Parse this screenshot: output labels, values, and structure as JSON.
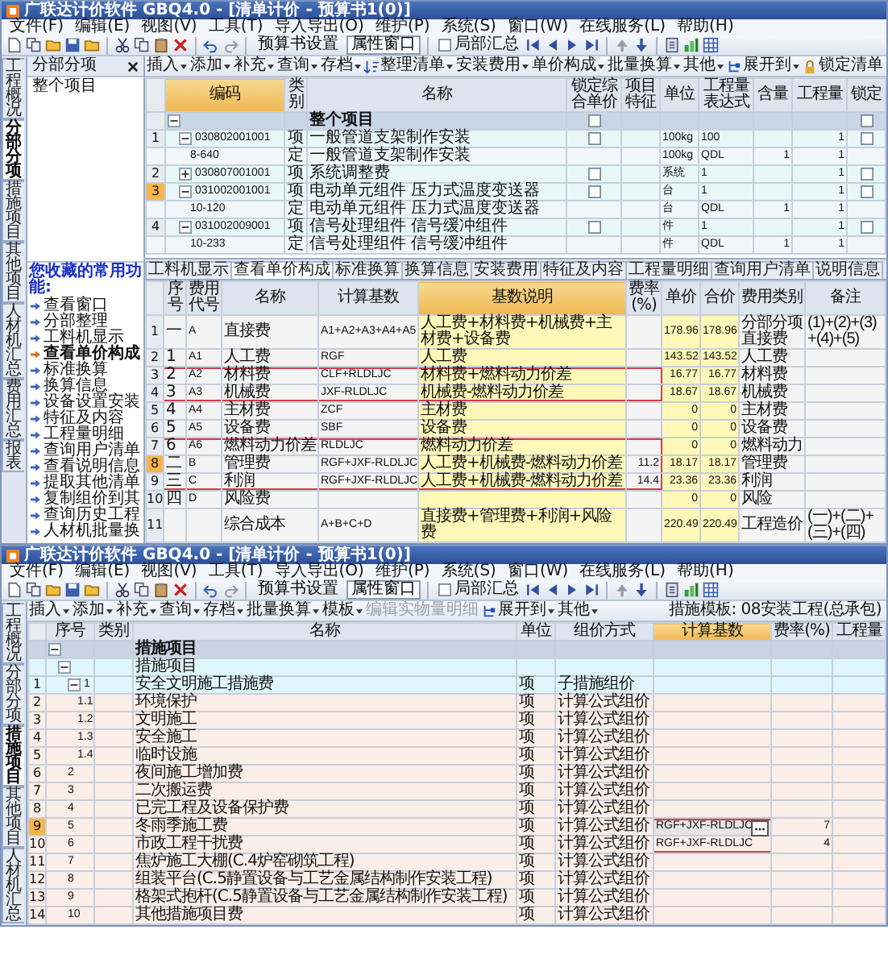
{
  "windows": [
    {
      "title": "广联达计价软件 GBQ4.0 - [清单计价 - 预算书1(0)]",
      "menu": [
        "文件(F)",
        "编辑(E)",
        "视图(V)",
        "工具(T)",
        "导入导出(O)",
        "维护(P)",
        "系统(S)",
        "窗口(W)",
        "在线服务(L)",
        "帮助(H)"
      ],
      "toolbar": {
        "buttons": [
          "预算书设置",
          "属性窗口"
        ],
        "summary": {
          "label": "局部汇总",
          "checked": false
        }
      },
      "side_tabs": [
        {
          "label": "工程概况",
          "selected": false
        },
        {
          "label": "分部分项",
          "selected": true
        },
        {
          "label": "措施项目",
          "selected": false
        },
        {
          "label": "其他项目",
          "selected": false
        },
        {
          "label": "人材机汇总",
          "selected": false
        },
        {
          "label": "费用汇总",
          "selected": false
        },
        {
          "label": "报表",
          "selected": false
        }
      ],
      "sidebar": {
        "title": "分部分项",
        "tree": [
          {
            "label": "整个项目"
          }
        ],
        "favorites_title": "您收藏的常用功能:",
        "favorites": [
          {
            "label": "查看窗口",
            "selected": false
          },
          {
            "label": "分部整理",
            "selected": false
          },
          {
            "label": "工料机显示",
            "selected": false
          },
          {
            "label": "查看单价构成",
            "selected": true
          },
          {
            "label": "标准换算",
            "selected": false
          },
          {
            "label": "换算信息",
            "selected": false
          },
          {
            "label": "设备设置安装",
            "selected": false
          },
          {
            "label": "特征及内容",
            "selected": false
          },
          {
            "label": "工程量明细",
            "selected": false
          },
          {
            "label": "查询用户清单",
            "selected": false
          },
          {
            "label": "查看说明信息",
            "selected": false
          },
          {
            "label": "提取其他清单",
            "selected": false
          },
          {
            "label": "复制组价到其",
            "selected": false
          },
          {
            "label": "查询历史工程",
            "selected": false
          },
          {
            "label": "人材机批量换",
            "selected": false
          }
        ]
      },
      "ribbon": [
        {
          "label": "插入",
          "kind": "menu",
          "disabled": false
        },
        {
          "label": "添加",
          "kind": "menu",
          "disabled": false
        },
        {
          "label": "补充",
          "kind": "menu",
          "disabled": false
        },
        {
          "label": "查询",
          "kind": "menu",
          "disabled": false
        },
        {
          "label": "存档",
          "kind": "menu",
          "disabled": false
        },
        {
          "label": "整理清单",
          "kind": "sort",
          "disabled": false
        },
        {
          "label": "安装费用",
          "kind": "menu",
          "disabled": false
        },
        {
          "label": "单价构成",
          "kind": "menu",
          "disabled": false
        },
        {
          "label": "批量换算",
          "kind": "menu",
          "disabled": false
        },
        {
          "label": "其他",
          "kind": "menu",
          "disabled": false
        },
        {
          "label": "展开到",
          "kind": "expand",
          "disabled": false
        },
        {
          "label": "锁定清单",
          "kind": "lock",
          "disabled": false
        }
      ],
      "bill_table": {
        "columns": [
          {
            "label": "编码",
            "selected": true
          },
          {
            "label": "类别",
            "selected": false
          },
          {
            "label": "名称",
            "selected": false
          },
          {
            "label": "锁定综合单价",
            "selected": false
          },
          {
            "label": "项目特征",
            "selected": false
          },
          {
            "label": "单位",
            "selected": false
          },
          {
            "label": "工程量表达式",
            "selected": false
          },
          {
            "label": "含量",
            "selected": false
          },
          {
            "label": "工程量",
            "selected": false
          },
          {
            "label": "锁定",
            "selected": false
          }
        ],
        "rows": [
          {
            "kind": "root",
            "name": "整个项目",
            "expanded": true,
            "lock_price": false,
            "lock": false,
            "selected": false,
            "children": [
              {
                "kind": "item",
                "index": "1",
                "code": "030802001001",
                "type": "项",
                "name": "一般管道支架制作安装",
                "unit": "100kg",
                "expression": "100",
                "quantity": "1",
                "expanded": true,
                "lock_price": false,
                "lock": false,
                "selected": false,
                "children": [
                  {
                    "kind": "quota",
                    "code": "8-640",
                    "type": "定",
                    "name": "一般管道支架制作安装",
                    "unit": "100kg",
                    "expression": "QDL",
                    "content": "1",
                    "quantity": "1",
                    "selected": false
                  }
                ]
              },
              {
                "kind": "item",
                "index": "2",
                "code": "030807001001",
                "type": "项",
                "name": "系统调整费",
                "unit": "系统",
                "expression": "1",
                "quantity": "1",
                "expanded": false,
                "lock_price": false,
                "lock": false,
                "selected": false
              },
              {
                "kind": "item",
                "index": "3",
                "code": "031002001001",
                "type": "项",
                "name": "电动单元组件 压力式温度变送器",
                "unit": "台",
                "expression": "1",
                "quantity": "1",
                "expanded": true,
                "lock_price": false,
                "lock": false,
                "selected": true,
                "children": [
                  {
                    "kind": "quota",
                    "code": "10-120",
                    "type": "定",
                    "name": "电动单元组件 压力式温度变送器",
                    "unit": "台",
                    "expression": "QDL",
                    "content": "1",
                    "quantity": "1",
                    "selected": false
                  }
                ]
              },
              {
                "kind": "item",
                "index": "4",
                "code": "031002009001",
                "type": "项",
                "name": "信号处理组件 信号缓冲组件",
                "unit": "件",
                "expression": "1",
                "quantity": "1",
                "expanded": true,
                "lock_price": false,
                "lock": false,
                "selected": false,
                "children": [
                  {
                    "kind": "quota",
                    "code": "10-233",
                    "type": "定",
                    "name": "信号处理组件 信号缓冲组件",
                    "unit": "件",
                    "expression": "QDL",
                    "content": "1",
                    "quantity": "1",
                    "selected": false
                  }
                ]
              }
            ]
          }
        ]
      },
      "detail_tabs": [
        {
          "label": "工料机显示",
          "selected": false
        },
        {
          "label": "查看单价构成",
          "selected": true
        },
        {
          "label": "标准换算",
          "selected": false
        },
        {
          "label": "换算信息",
          "selected": false
        },
        {
          "label": "安装费用",
          "selected": false
        },
        {
          "label": "特征及内容",
          "selected": false
        },
        {
          "label": "工程量明细",
          "selected": false
        },
        {
          "label": "查询用户清单",
          "selected": false
        },
        {
          "label": "说明信息",
          "selected": false
        }
      ],
      "cost_table": {
        "columns": [
          {
            "label": "序号",
            "selected": false
          },
          {
            "label": "费用代号",
            "selected": false
          },
          {
            "label": "名称",
            "selected": false
          },
          {
            "label": "计算基数",
            "selected": false
          },
          {
            "label": "基数说明",
            "selected": true
          },
          {
            "label": "费率(%)",
            "selected": false
          },
          {
            "label": "单价",
            "selected": false
          },
          {
            "label": "合价",
            "selected": false
          },
          {
            "label": "费用类别",
            "selected": false
          },
          {
            "label": "备注",
            "selected": false
          }
        ],
        "rows": [
          {
            "index": "1",
            "number": "一",
            "code": "A",
            "name": "直接费",
            "base": "A1+A2+A3+A4+A5",
            "base_desc": "人工费+材料费+机械费+主材费+设备费",
            "unit_price": "178.96",
            "total": "178.96",
            "category": "分部分项直接费",
            "remark": "(1)+(2)+(3)+(4)+(5)",
            "selected": false,
            "boxed": false
          },
          {
            "index": "2",
            "number": "1",
            "code": "A1",
            "name": "人工费",
            "base": "RGF",
            "base_desc": "人工费",
            "unit_price": "143.52",
            "total": "143.52",
            "category": "人工费",
            "selected": false,
            "boxed": false
          },
          {
            "index": "3",
            "number": "2",
            "code": "A2",
            "name": "材料费",
            "base": "CLF+RLDLJC",
            "base_desc": "材料费+燃料动力价差",
            "unit_price": "16.77",
            "total": "16.77",
            "category": "材料费",
            "selected": false,
            "boxed": true
          },
          {
            "index": "4",
            "number": "3",
            "code": "A3",
            "name": "机械费",
            "base": "JXF-RLDLJC",
            "base_desc": "机械费-燃料动力价差",
            "unit_price": "18.67",
            "total": "18.67",
            "category": "机械费",
            "selected": false,
            "boxed": true
          },
          {
            "index": "5",
            "number": "4",
            "code": "A4",
            "name": "主材费",
            "base": "ZCF",
            "base_desc": "主材费",
            "unit_price": "0",
            "total": "0",
            "category": "主材费",
            "selected": false,
            "boxed": false
          },
          {
            "index": "6",
            "number": "5",
            "code": "A5",
            "name": "设备费",
            "base": "SBF",
            "base_desc": "设备费",
            "unit_price": "0",
            "total": "0",
            "category": "设备费",
            "selected": false,
            "boxed": false
          },
          {
            "index": "7",
            "number": "6",
            "code": "A6",
            "name": "燃料动力价差",
            "base": "RLDLJC",
            "base_desc": "燃料动力价差",
            "unit_price": "0",
            "total": "0",
            "category": "燃料动力",
            "selected": false,
            "boxed": true
          },
          {
            "index": "8",
            "number": "二",
            "code": "B",
            "name": "管理费",
            "base": "RGF+JXF-RLDLJC",
            "base_desc": "人工费+机械费-燃料动力价差",
            "rate": "11.2",
            "unit_price": "18.17",
            "total": "18.17",
            "category": "管理费",
            "selected": true,
            "boxed": true
          },
          {
            "index": "9",
            "number": "三",
            "code": "C",
            "name": "利润",
            "base": "RGF+JXF-RLDLJC",
            "base_desc": "人工费+机械费-燃料动力价差",
            "rate": "14.4",
            "unit_price": "23.36",
            "total": "23.36",
            "category": "利润",
            "selected": false,
            "boxed": true
          },
          {
            "index": "10",
            "number": "四",
            "code": "D",
            "name": "风险费",
            "unit_price": "0",
            "total": "0",
            "category": "风险",
            "selected": false,
            "boxed": false
          },
          {
            "index": "11",
            "name": "综合成本",
            "base": "A+B+C+D",
            "base_desc": "直接费+管理费+利润+风险费",
            "unit_price": "220.49",
            "total": "220.49",
            "category": "工程造价",
            "remark": "(一)+(二)+(三)+(四)",
            "selected": false,
            "boxed": false
          }
        ]
      }
    },
    {
      "title": "广联达计价软件 GBQ4.0 - [清单计价 - 预算书1(0)]",
      "menu": [
        "文件(F)",
        "编辑(E)",
        "视图(V)",
        "工具(T)",
        "导入导出(O)",
        "维护(P)",
        "系统(S)",
        "窗口(W)",
        "在线服务(L)",
        "帮助(H)"
      ],
      "toolbar": {
        "buttons": [
          "预算书设置",
          "属性窗口"
        ],
        "summary": {
          "label": "局部汇总",
          "checked": false
        }
      },
      "side_tabs": [
        {
          "label": "工程概况",
          "selected": false
        },
        {
          "label": "分部分项",
          "selected": false
        },
        {
          "label": "措施项目",
          "selected": true
        },
        {
          "label": "其他项目",
          "selected": false
        },
        {
          "label": "人材机汇总",
          "selected": false
        }
      ],
      "ribbon": [
        {
          "label": "插入",
          "kind": "menu",
          "disabled": false
        },
        {
          "label": "添加",
          "kind": "menu",
          "disabled": false
        },
        {
          "label": "补充",
          "kind": "menu",
          "disabled": false
        },
        {
          "label": "查询",
          "kind": "menu",
          "disabled": false
        },
        {
          "label": "存档",
          "kind": "menu",
          "disabled": false
        },
        {
          "label": "批量换算",
          "kind": "menu",
          "disabled": false
        },
        {
          "label": "模板",
          "kind": "menu",
          "disabled": false
        },
        {
          "label": "编辑实物量明细",
          "kind": "plain",
          "disabled": true
        },
        {
          "label": "展开到",
          "kind": "expand",
          "disabled": false
        },
        {
          "label": "其他",
          "kind": "menu",
          "disabled": false
        }
      ],
      "template": {
        "label": "措施模板:",
        "value": "08安装工程(总承包)"
      },
      "measures_table": {
        "columns": [
          {
            "label": "序号",
            "selected": false
          },
          {
            "label": "类别",
            "selected": false
          },
          {
            "label": "名称",
            "selected": false
          },
          {
            "label": "单位",
            "selected": false
          },
          {
            "label": "组价方式",
            "selected": false
          },
          {
            "label": "计算基数",
            "selected": true
          },
          {
            "label": "费率(%)",
            "selected": false
          },
          {
            "label": "工程量",
            "selected": false
          }
        ],
        "rows": [
          {
            "kind": "root",
            "name": "措施项目",
            "expanded": true,
            "selected": false,
            "boxed": false,
            "children": [
              {
                "kind": "group",
                "name": "措施项目",
                "expanded": true,
                "selected": false,
                "boxed": false,
                "children": [
                  {
                    "kind": "group",
                    "index": "1",
                    "number": "1",
                    "name": "安全文明施工措施费",
                    "unit": "项",
                    "method": "子措施组价",
                    "expanded": true,
                    "selected": false,
                    "boxed": false,
                    "children": [
                      {
                        "kind": "item",
                        "index": "2",
                        "number": "1.1",
                        "name": "环境保护",
                        "unit": "项",
                        "method": "计算公式组价",
                        "selected": false,
                        "boxed": false
                      },
                      {
                        "kind": "item",
                        "index": "3",
                        "number": "1.2",
                        "name": "文明施工",
                        "unit": "项",
                        "method": "计算公式组价",
                        "selected": false,
                        "boxed": false
                      },
                      {
                        "kind": "item",
                        "index": "4",
                        "number": "1.3",
                        "name": "安全施工",
                        "unit": "项",
                        "method": "计算公式组价",
                        "selected": false,
                        "boxed": false
                      },
                      {
                        "kind": "item",
                        "index": "5",
                        "number": "1.4",
                        "name": "临时设施",
                        "unit": "项",
                        "method": "计算公式组价",
                        "selected": false,
                        "boxed": false
                      }
                    ]
                  },
                  {
                    "kind": "item",
                    "index": "6",
                    "number": "2",
                    "name": "夜间施工增加费",
                    "unit": "项",
                    "method": "计算公式组价",
                    "selected": false,
                    "boxed": false
                  },
                  {
                    "kind": "item",
                    "index": "7",
                    "number": "3",
                    "name": "二次搬运费",
                    "unit": "项",
                    "method": "计算公式组价",
                    "selected": false,
                    "boxed": false
                  },
                  {
                    "kind": "item",
                    "index": "8",
                    "number": "4",
                    "name": "已完工程及设备保护费",
                    "unit": "项",
                    "method": "计算公式组价",
                    "selected": false,
                    "boxed": false
                  },
                  {
                    "kind": "item",
                    "index": "9",
                    "number": "5",
                    "name": "冬雨季施工费",
                    "unit": "项",
                    "method": "计算公式组价",
                    "base": "RGF+JXF-RLDLJC",
                    "rate": "7",
                    "selected": true,
                    "boxed": true
                  },
                  {
                    "kind": "item",
                    "index": "10",
                    "number": "6",
                    "name": "市政工程干扰费",
                    "unit": "项",
                    "method": "计算公式组价",
                    "base": "RGF+JXF-RLDLJC",
                    "rate": "4",
                    "selected": false,
                    "boxed": true
                  },
                  {
                    "kind": "item",
                    "index": "11",
                    "number": "7",
                    "name": "焦炉施工大棚(C.4炉窑砌筑工程)",
                    "unit": "项",
                    "method": "计算公式组价",
                    "selected": false,
                    "boxed": false
                  },
                  {
                    "kind": "item",
                    "index": "12",
                    "number": "8",
                    "name": "组装平台(C.5静置设备与工艺金属结构制作安装工程)",
                    "unit": "项",
                    "method": "计算公式组价",
                    "selected": false,
                    "boxed": false
                  },
                  {
                    "kind": "item",
                    "index": "13",
                    "number": "9",
                    "name": "格架式抱杆(C.5静置设备与工艺金属结构制作安装工程)",
                    "unit": "项",
                    "method": "计算公式组价",
                    "selected": false,
                    "boxed": false
                  },
                  {
                    "kind": "item",
                    "index": "14",
                    "number": "10",
                    "name": "其他措施项目费",
                    "unit": "项",
                    "method": "计算公式组价",
                    "selected": false,
                    "boxed": false
                  }
                ]
              }
            ]
          }
        ]
      }
    }
  ]
}
